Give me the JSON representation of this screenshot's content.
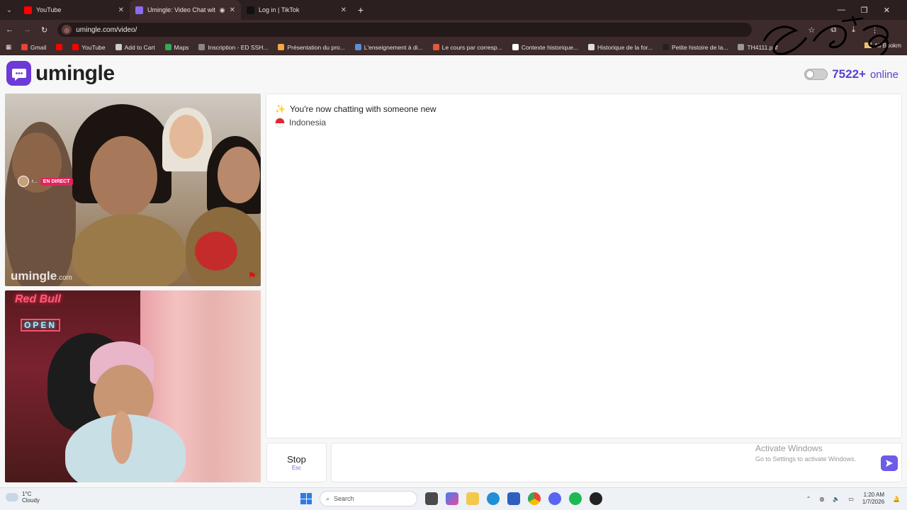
{
  "browser": {
    "tabs": [
      {
        "title": "YouTube",
        "color": "#ff0000",
        "active": false
      },
      {
        "title": "Umingle: Video Chat with S",
        "color": "#8a6cf0",
        "active": true
      },
      {
        "title": "Log in | TikTok",
        "color": "#111111",
        "active": false
      }
    ],
    "url": "umingle.com/video/",
    "bookmarks": [
      {
        "label": "Gmail",
        "color": "#ea4335"
      },
      {
        "label": "",
        "color": "#ff0000"
      },
      {
        "label": "YouTube",
        "color": "#ff0000"
      },
      {
        "label": "Add to Cart",
        "color": "#cccccc"
      },
      {
        "label": "Maps",
        "color": "#34a853"
      },
      {
        "label": "Inscription - ED SSH...",
        "color": "#888888"
      },
      {
        "label": "Présentation du pro...",
        "color": "#f4a742"
      },
      {
        "label": "L'enseignement à di...",
        "color": "#5b8dd9"
      },
      {
        "label": "Le cours par corresp...",
        "color": "#e05a3a"
      },
      {
        "label": "Contexte historique...",
        "color": "#ffffff"
      },
      {
        "label": "Historique de la for...",
        "color": "#dddddd"
      },
      {
        "label": "Petite histoire de la...",
        "color": "#222222"
      },
      {
        "label": "TH4111.pdf",
        "color": "#999999"
      }
    ],
    "all_bookmarks": "All Bookm"
  },
  "site": {
    "name": "umingle",
    "online_count": "7522+",
    "online_label": "online",
    "brand_color": "#6c3ad6"
  },
  "remote_video": {
    "watermark": "umingle",
    "watermark_suffix": ".com",
    "live_badge": "EN DIRECT",
    "live_user": "r..."
  },
  "self_video": {
    "neon_sign": "Red Bull",
    "neon_open": "OPEN"
  },
  "chat": {
    "system_message": "You're now chatting with someone new",
    "system_icon": "sparkles-icon",
    "country": "Indonesia"
  },
  "controls": {
    "stop_label": "Stop",
    "stop_hint": "Esc",
    "message_placeholder": ""
  },
  "activation": {
    "title": "Activate Windows",
    "subtitle": "Go to Settings to activate Windows."
  },
  "taskbar": {
    "weather_temp": "1°C",
    "weather_desc": "Cloudy",
    "search_label": "Search",
    "time": "1:20 AM",
    "date": "1/7/2026"
  }
}
